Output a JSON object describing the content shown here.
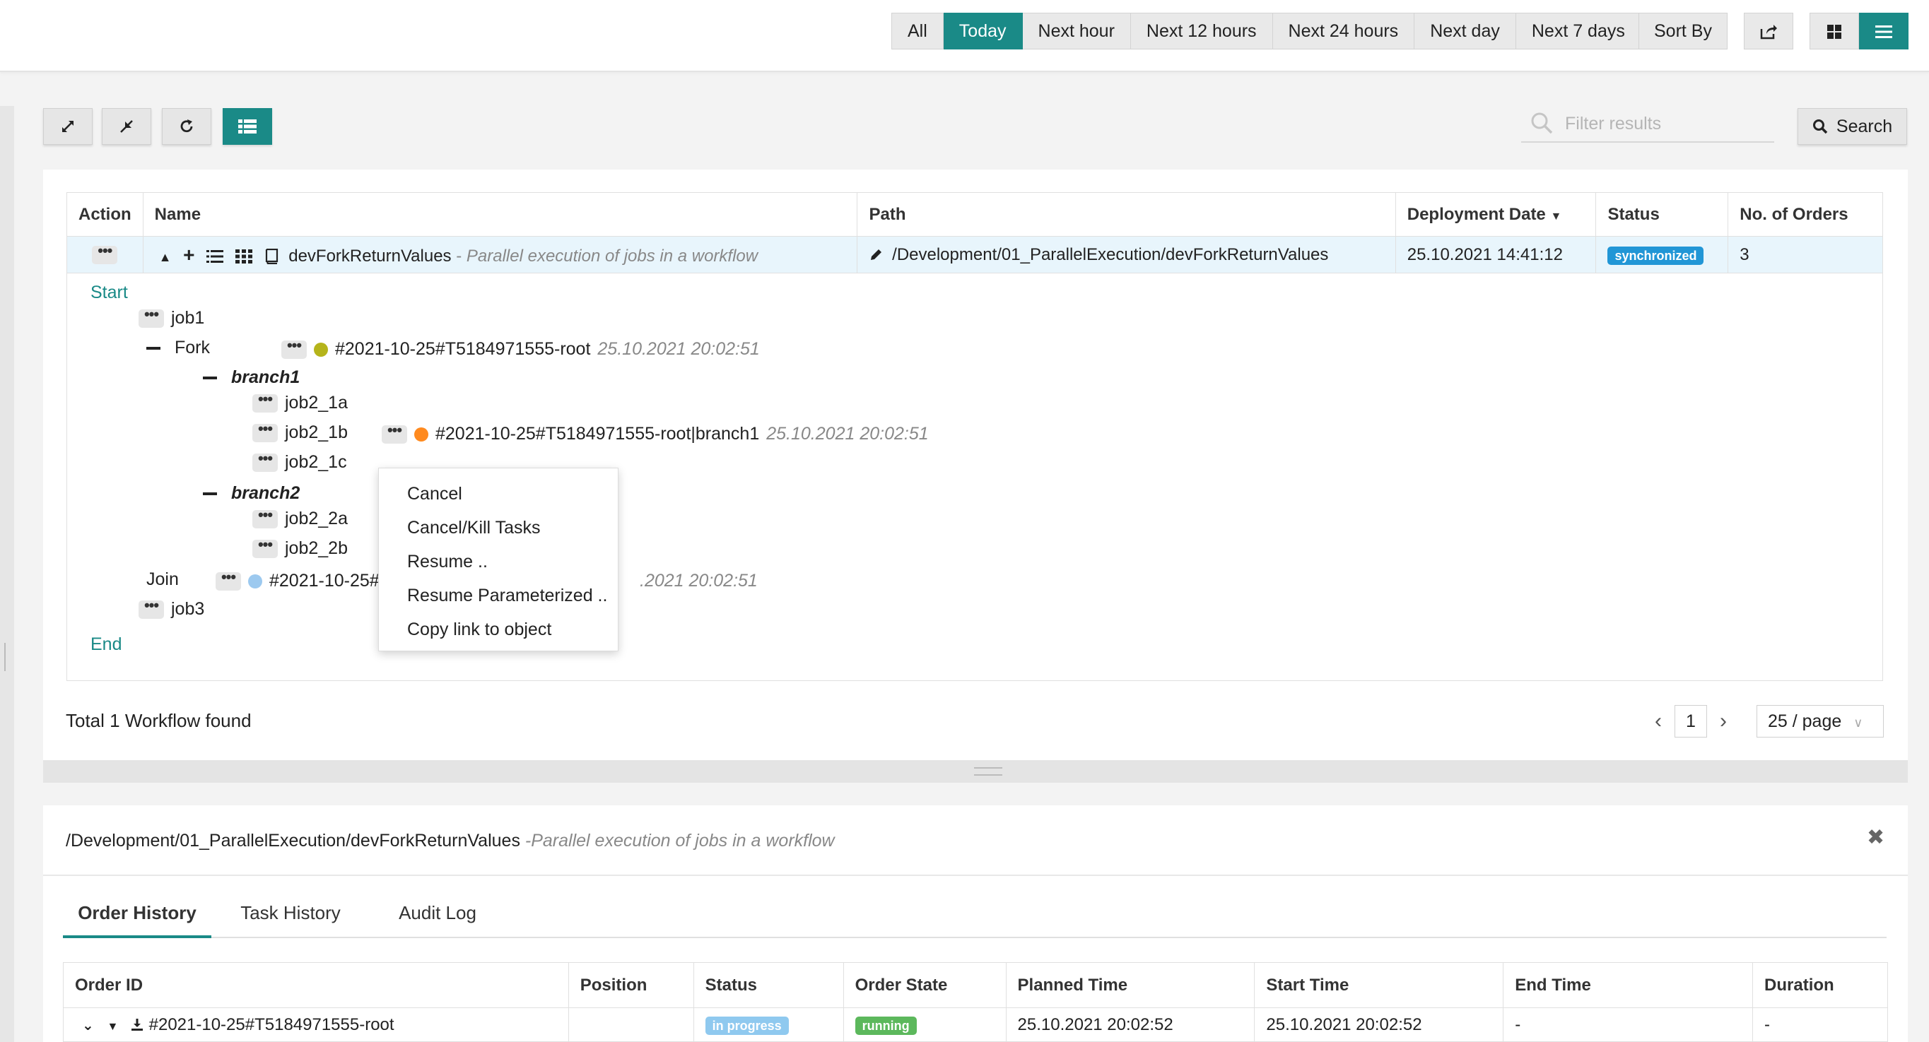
{
  "topbar": {
    "ranges": [
      "All",
      "Today",
      "Next hour",
      "Next 12 hours",
      "Next 24 hours",
      "Next day",
      "Next 7 days"
    ],
    "active_range": "Today",
    "sort_label": "Sort By"
  },
  "filter": {
    "placeholder": "Filter results",
    "search_label": "Search"
  },
  "workflows_table": {
    "headers": [
      "Action",
      "Name",
      "Path",
      "Deployment Date",
      "Status",
      "No. of Orders"
    ],
    "row": {
      "name": "devForkReturnValues",
      "separator": " - ",
      "description": "Parallel execution of jobs in a workflow",
      "path": "/Development/01_ParallelExecution/devForkReturnValues",
      "deployment_date": "25.10.2021 14:41:12",
      "status": "synchronized",
      "orders": "3"
    }
  },
  "tree": {
    "start": "Start",
    "job1": "job1",
    "fork": "Fork",
    "fork_order": "#2021-10-25#T5184971555-root",
    "fork_time": "25.10.2021 20:02:51",
    "branch1": "branch1",
    "job2_1a": "job2_1a",
    "job2_1b": "job2_1b",
    "job2_1b_order": "#2021-10-25#T5184971555-root|branch1",
    "job2_1b_time": "25.10.2021 20:02:51",
    "job2_1c": "job2_1c",
    "branch2": "branch2",
    "job2_2a": "job2_2a",
    "job2_2b": "job2_2b",
    "join": "Join",
    "join_order": "#2021-10-25#",
    "join_time": ".2021 20:02:51",
    "job3": "job3",
    "end": "End",
    "colors": {
      "fork_dot": "#b5b41b",
      "branch_dot": "#ff8a1f",
      "join_dot": "#9cc9ef"
    }
  },
  "context_menu": [
    "Cancel",
    "Cancel/Kill Tasks",
    "Resume ..",
    "Resume Parameterized ..",
    "Copy link to object"
  ],
  "footer": {
    "total": "Total 1 Workflow found",
    "page": "1",
    "per_page": "25 / page"
  },
  "detail": {
    "path": "/Development/01_ParallelExecution/devForkReturnValues",
    "description": "-Parallel execution of jobs in a workflow",
    "tabs": [
      "Order History",
      "Task History",
      "Audit Log"
    ],
    "headers": [
      "Order ID",
      "Position",
      "Status",
      "Order State",
      "Planned Time",
      "Start Time",
      "End Time",
      "Duration"
    ],
    "row": {
      "order_id": "#2021-10-25#T5184971555-root",
      "position": "",
      "status": "in progress",
      "order_state": "running",
      "planned": "25.10.2021 20:02:52",
      "start": "25.10.2021 20:02:52",
      "end": "-",
      "duration": "-"
    }
  },
  "accent_color": "#1a8a87"
}
